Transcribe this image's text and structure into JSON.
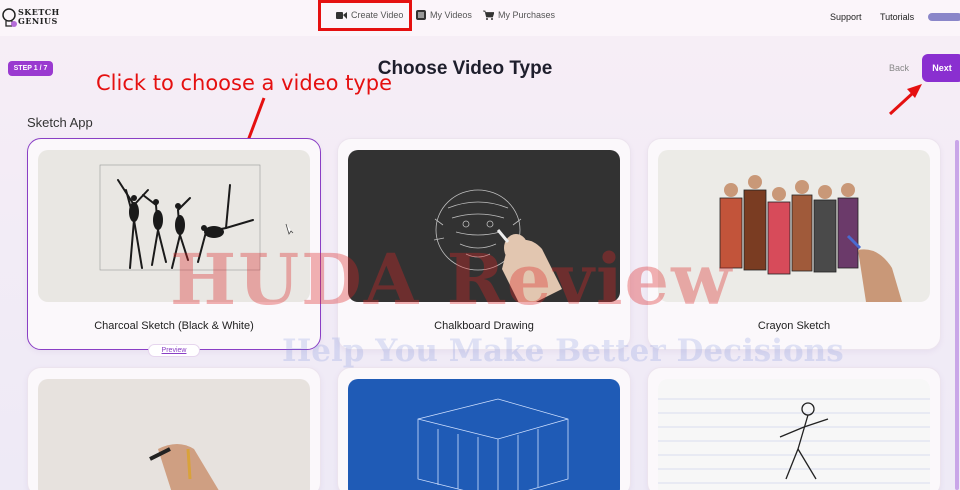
{
  "app": {
    "logo_text_1": "SKETCH",
    "logo_text_2": "GENIUS"
  },
  "nav": {
    "create_video": "Create Video",
    "my_videos": "My Videos",
    "my_purchases": "My Purchases",
    "support": "Support",
    "tutorials": "Tutorials"
  },
  "header": {
    "step": "STEP 1 / 7",
    "title": "Choose Video Type",
    "back": "Back",
    "next": "Next"
  },
  "annotation": {
    "text": "Click to choose a video type"
  },
  "section": {
    "title": "Sketch App"
  },
  "cards": [
    {
      "label": "Charcoal Sketch (Black & White)",
      "selected": true,
      "preview_label": "Preview"
    },
    {
      "label": "Chalkboard Drawing",
      "selected": false
    },
    {
      "label": "Crayon Sketch",
      "selected": false
    },
    {
      "label": "",
      "selected": false
    },
    {
      "label": "",
      "selected": false
    },
    {
      "label": "",
      "selected": false
    }
  ],
  "watermark": {
    "line1": "HUDA Review",
    "line2": "Help You Make Better Decisions"
  },
  "colors": {
    "accent": "#8a2fd0",
    "annotation": "#e51010"
  }
}
